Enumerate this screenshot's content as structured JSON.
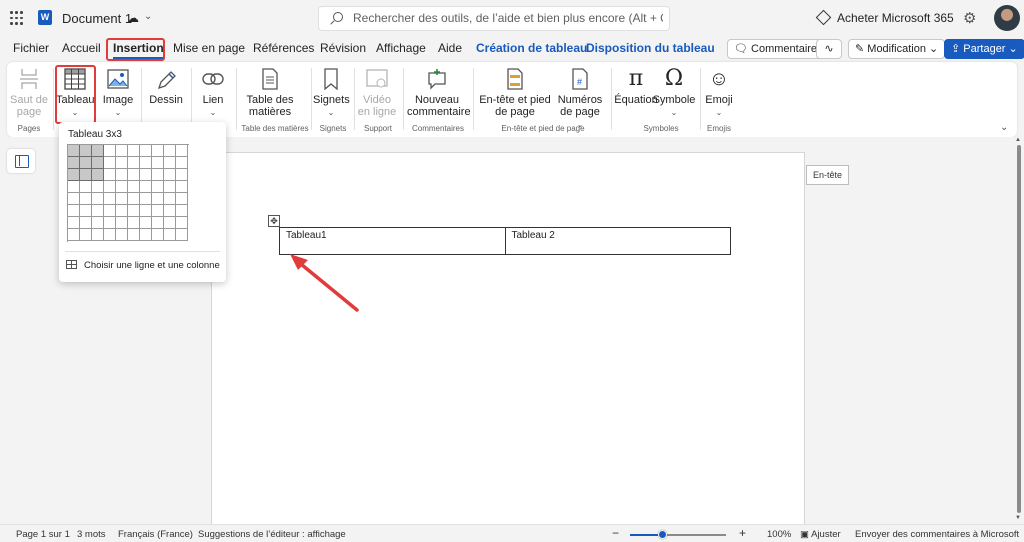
{
  "titlebar": {
    "doc_title": "Document 1",
    "doc_status_icon": "cloud-check-icon",
    "search_placeholder": "Rechercher des outils, de l’aide et bien plus encore (Alt + Q)",
    "buy_label": "Acheter Microsoft 365"
  },
  "tabs": [
    {
      "label": "Fichier"
    },
    {
      "label": "Accueil"
    },
    {
      "label": "Insertion"
    },
    {
      "label": "Mise en page"
    },
    {
      "label": "Références"
    },
    {
      "label": "Révision"
    },
    {
      "label": "Affichage"
    },
    {
      "label": "Aide"
    },
    {
      "label": "Création de tableau"
    },
    {
      "label": "Disposition du tableau"
    }
  ],
  "header_buttons": {
    "comments": "Commentaires",
    "editing": "Modification",
    "share": "Partager"
  },
  "ribbon": {
    "buttons": {
      "saut": "Saut de page",
      "tableau": "Tableau",
      "image": "Image",
      "dessin": "Dessin",
      "lien": "Lien",
      "table_matieres": "Table des matières",
      "signets": "Signets",
      "video": "Vidéo en ligne",
      "commentaire": "Nouveau commentaire",
      "entete_pied": "En-tête et pied de page",
      "numeros": "Numéros de page",
      "equation": "Équation",
      "symbole": "Symbole",
      "emoji": "Emoji"
    },
    "groups": {
      "pages": "Pages",
      "table_matieres": "Table des matières",
      "signets": "Signets",
      "support": "Support",
      "commentaires": "Commentaires",
      "entete": "En-tête et pied de page",
      "symboles": "Symboles",
      "emojis": "Emojis"
    }
  },
  "dropdown": {
    "title": "Tableau 3x3",
    "grid_cols": 10,
    "grid_rows": 8,
    "selected_cols": 3,
    "selected_rows": 3,
    "choose_label": "Choisir une ligne et une colonne"
  },
  "document": {
    "header_tag": "En-tête",
    "table": [
      [
        "Tableau1",
        "Tableau 2"
      ]
    ]
  },
  "statusbar": {
    "page": "Page 1 sur 1",
    "words": "3 mots",
    "language": "Français (France)",
    "suggestions": "Suggestions de l’éditeur : affichage",
    "zoom": "100%",
    "zoom_fraction": 0.33,
    "fit": "Ajuster",
    "feedback": "Envoyer des commentaires à Microsoft"
  },
  "colors": {
    "accent": "#185abd",
    "highlight": "#e03c3c"
  }
}
